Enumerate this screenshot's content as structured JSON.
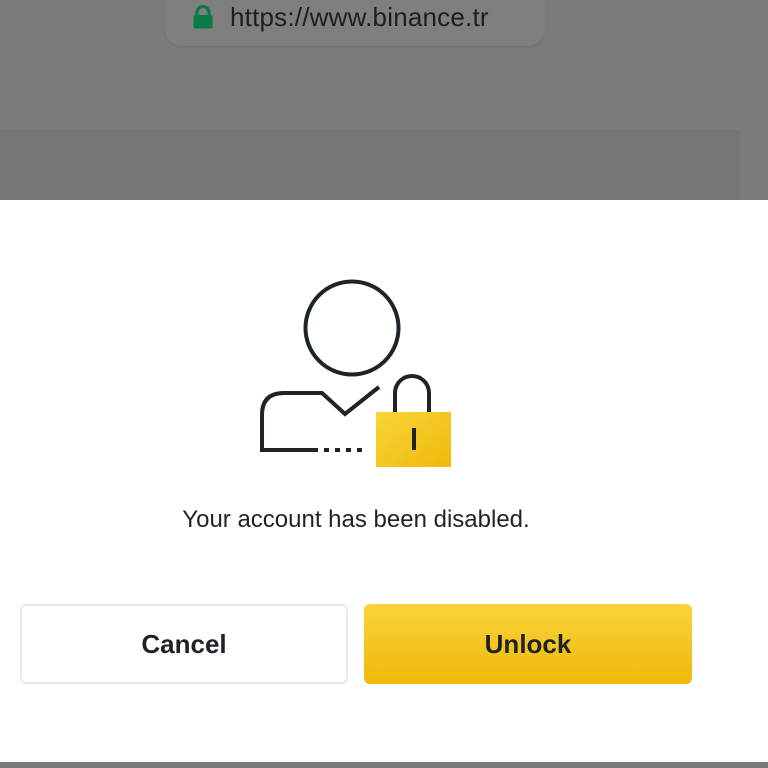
{
  "browser": {
    "url": "https://www.binance.tr",
    "secure_icon": "lock-icon"
  },
  "dialog": {
    "illustration": "user-locked-icon",
    "message": "Your account has been disabled.",
    "buttons": {
      "cancel_label": "Cancel",
      "unlock_label": "Unlock"
    }
  },
  "colors": {
    "accent": "#F0B90B",
    "text": "#1E2329",
    "secure_lock": "#0B7A45",
    "overlay": "#7A7A7A"
  }
}
